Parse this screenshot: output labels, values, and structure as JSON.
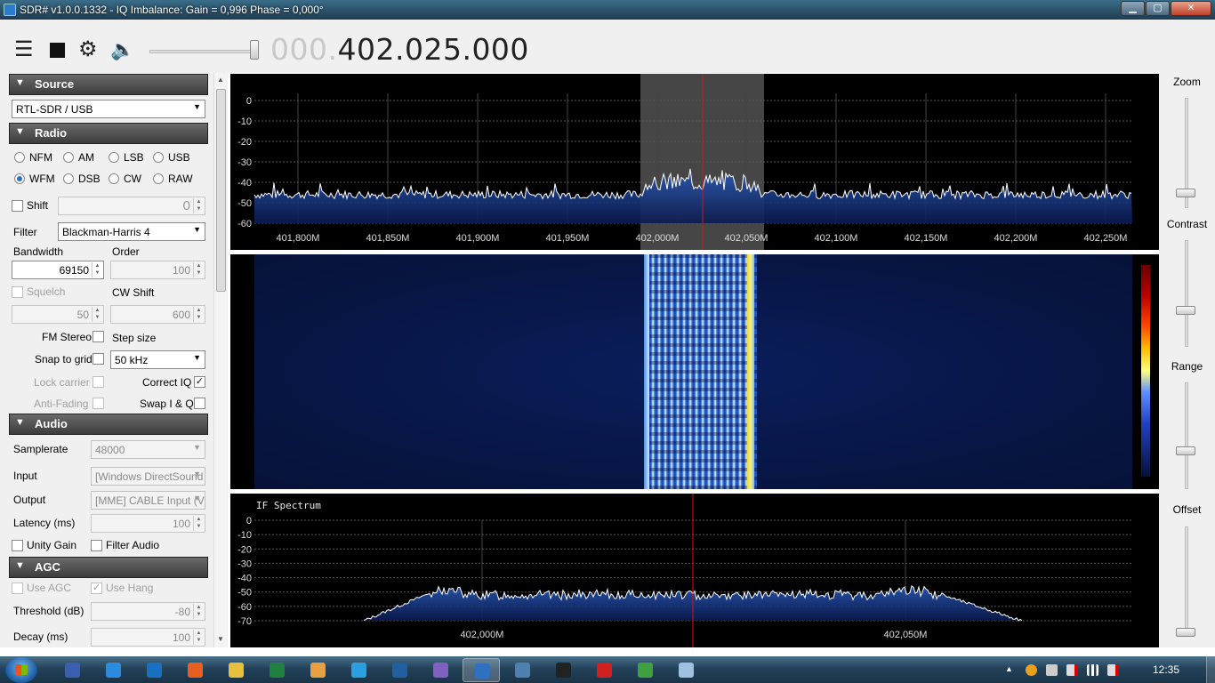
{
  "window": {
    "title": "SDR# v1.0.0.1332 - IQ Imbalance: Gain = 0,996 Phase = 0,000°",
    "buttons": {
      "minimize": "▁",
      "maximize": "▢",
      "close": "✕"
    }
  },
  "toolbar": {
    "menu_icon": "hamburger-menu-icon",
    "stop_icon": "stop-icon",
    "settings_icon": "gear-icon",
    "audio_icon": "speaker-icon",
    "volume_level": 1.0,
    "frequency_dim": "000.",
    "frequency_main": "402.025.000"
  },
  "source": {
    "header": "Source",
    "device": "RTL-SDR / USB"
  },
  "radio": {
    "header": "Radio",
    "modes": [
      "NFM",
      "AM",
      "LSB",
      "USB",
      "WFM",
      "DSB",
      "CW",
      "RAW"
    ],
    "selected_mode": "WFM",
    "shift_label": "Shift",
    "shift_value": "0",
    "filter_label": "Filter",
    "filter_value": "Blackman-Harris 4",
    "bandwidth_label": "Bandwidth",
    "bandwidth_value": "69150",
    "order_label": "Order",
    "order_value": "100",
    "squelch_label": "Squelch",
    "squelch_value": "50",
    "cw_shift_label": "CW Shift",
    "cw_shift_value": "600",
    "fm_stereo_label": "FM Stereo",
    "step_size_label": "Step size",
    "snap_label": "Snap to grid",
    "step_value": "50 kHz",
    "lock_carrier_label": "Lock carrier",
    "correct_iq_label": "Correct IQ",
    "anti_fading_label": "Anti-Fading",
    "swap_iq_label": "Swap I & Q"
  },
  "audio": {
    "header": "Audio",
    "samplerate_label": "Samplerate",
    "samplerate_value": "48000",
    "input_label": "Input",
    "input_value": "[Windows DirectSound",
    "output_label": "Output",
    "output_value": "[MME] CABLE Input (V",
    "latency_label": "Latency (ms)",
    "latency_value": "100",
    "unity_gain_label": "Unity Gain",
    "filter_audio_label": "Filter Audio"
  },
  "agc": {
    "header": "AGC",
    "use_agc_label": "Use AGC",
    "use_hang_label": "Use Hang",
    "threshold_label": "Threshold (dB)",
    "threshold_value": "-80",
    "decay_label": "Decay (ms)",
    "decay_value": "100"
  },
  "spectrum": {
    "y_ticks": [
      "0",
      "-10",
      "-20",
      "-30",
      "-40",
      "-50",
      "-60"
    ],
    "x_ticks": [
      "401,800M",
      "401,850M",
      "401,900M",
      "401,950M",
      "402,000M",
      "402,050M",
      "402,100M",
      "402,150M",
      "402,200M",
      "402,250M"
    ]
  },
  "if_spectrum": {
    "title": "IF Spectrum",
    "y_ticks": [
      "0",
      "-10",
      "-20",
      "-30",
      "-40",
      "-50",
      "-60",
      "-70"
    ],
    "x_ticks": [
      "402,000M",
      "402,050M"
    ]
  },
  "right_panel": {
    "zoom_label": "Zoom",
    "contrast_label": "Contrast",
    "range_label": "Range",
    "offset_label": "Offset"
  },
  "taskbar": {
    "clock": "12:35",
    "apps": [
      "save-icon",
      "internet-explorer-icon",
      "outlook-icon",
      "firefox-icon",
      "file-explorer-icon",
      "excel-icon",
      "sticky-app-icon",
      "skype-icon",
      "security-shield-icon",
      "viber-icon",
      "sdrsharp-icon",
      "dialog-icon",
      "cmd-icon",
      "pdf-reader-icon",
      "map-app-icon",
      "notepad-icon"
    ]
  },
  "colors": {
    "spectrum_fill": "#1e4aa0",
    "spectrum_line": "#ffffff",
    "center_line": "#e01010",
    "filter_overlay": "#7f7f7f"
  }
}
